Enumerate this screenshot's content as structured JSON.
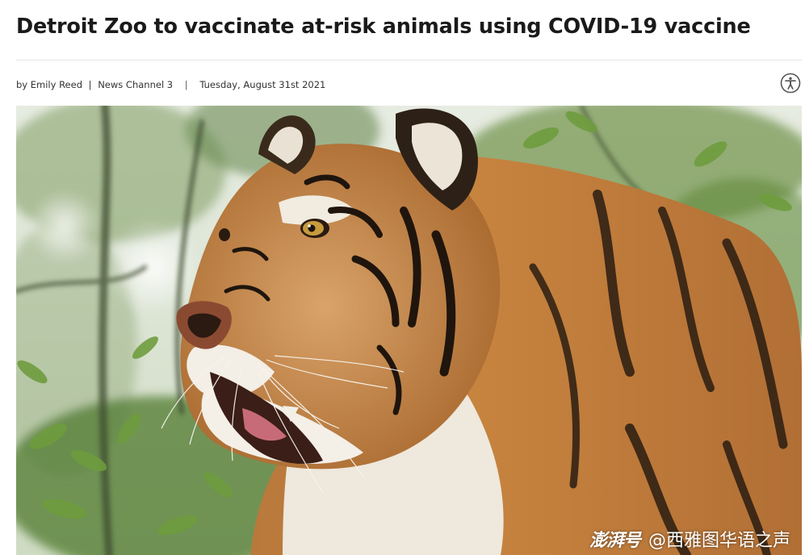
{
  "article": {
    "headline": "Detroit Zoo to vaccinate at-risk animals using COVID-19 vaccine",
    "author": "by Emily Reed",
    "byline_separator": "|",
    "source": "News Channel 3",
    "date_separator": "|",
    "date": "Tuesday, August 31st 2021"
  },
  "accessibility_button": {
    "icon": "accessibility-icon"
  },
  "hero_image": {
    "subject": "tiger-photo"
  },
  "watermark": {
    "logo": "澎湃号",
    "account": "@西雅图华语之声"
  },
  "colors": {
    "headline": "#1a1a1a",
    "byline": "#333333",
    "divider": "#e6e6e6",
    "tiger_orange": "#c7843f",
    "foliage": "#5f8a3a"
  }
}
